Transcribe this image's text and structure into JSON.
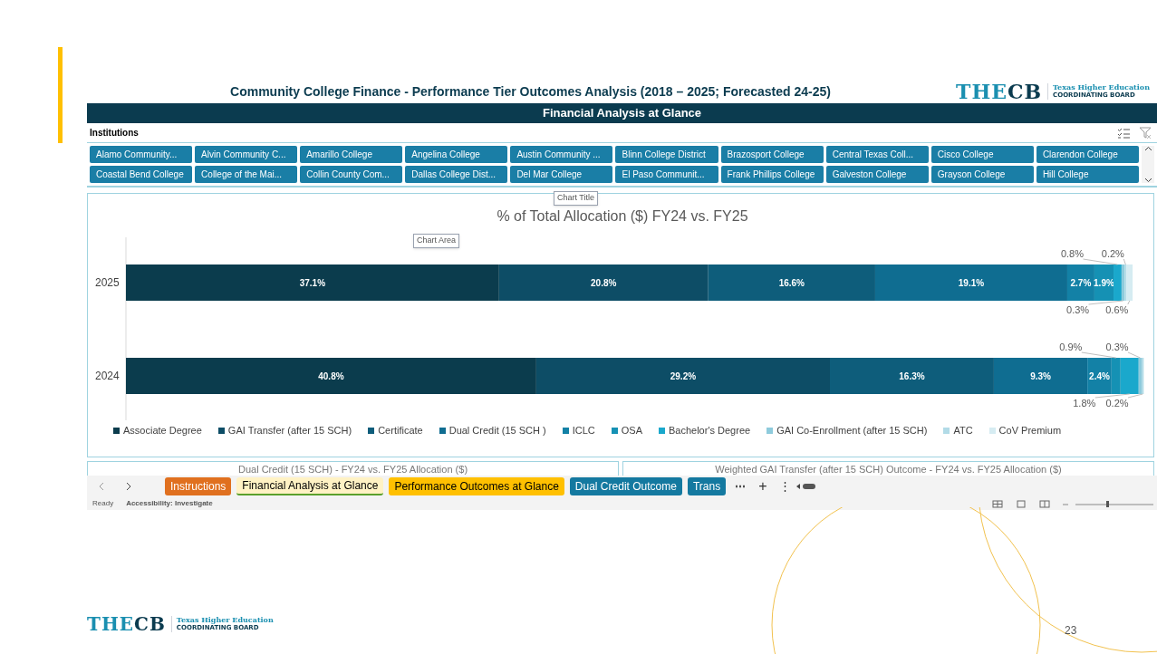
{
  "header": {
    "title": "Community College Finance - Performance Tier Outcomes Analysis (2018 – 2025; Forecasted 24-25)",
    "logo": {
      "part1": "THE",
      "part2": "CB",
      "tagline1": "Texas Higher Education",
      "tagline2": "COORDINATING BOARD"
    }
  },
  "banner": "Financial Analysis at Glance",
  "slicer": {
    "label": "Institutions",
    "items": [
      {
        "label": "Alamo Community..."
      },
      {
        "label": "Alvin Community C..."
      },
      {
        "label": "Amarillo College"
      },
      {
        "label": "Angelina College"
      },
      {
        "label": "Austin Community ..."
      },
      {
        "label": "Blinn College District"
      },
      {
        "label": "Brazosport College"
      },
      {
        "label": "Central Texas Coll..."
      },
      {
        "label": "Cisco College"
      },
      {
        "label": "Clarendon College"
      },
      {
        "label": "Coastal Bend College"
      },
      {
        "label": "College of the Mai..."
      },
      {
        "label": "Collin County Com..."
      },
      {
        "label": "Dallas College Dist..."
      },
      {
        "label": "Del Mar College"
      },
      {
        "label": "El Paso Communit..."
      },
      {
        "label": "Frank Phillips College"
      },
      {
        "label": "Galveston College"
      },
      {
        "label": "Grayson College"
      },
      {
        "label": "Hill College"
      }
    ]
  },
  "tooltips": {
    "chart_title": "Chart Title",
    "chart_area": "Chart Area"
  },
  "chart_data": {
    "type": "bar",
    "orientation": "horizontal",
    "stacked": true,
    "legend": true,
    "title": "% of Total Allocation ($) FY24 vs. FY25",
    "categories": [
      "2025",
      "2024"
    ],
    "series": [
      {
        "name": "Associate Degree",
        "color": "#0b3c4d",
        "values": [
          37.1,
          40.8
        ],
        "value_labels": [
          "37.1%",
          "40.8%"
        ]
      },
      {
        "name": "GAI Transfer (after 15 SCH)",
        "color": "#0d4d66",
        "values": [
          20.8,
          29.2
        ],
        "value_labels": [
          "20.8%",
          "29.2%"
        ]
      },
      {
        "name": "Certificate",
        "color": "#0e5d7b",
        "values": [
          16.6,
          16.3
        ],
        "value_labels": [
          "16.6%",
          "16.3%"
        ]
      },
      {
        "name": "Dual Credit (15 SCH )",
        "color": "#0f6d91",
        "values": [
          19.1,
          9.3
        ],
        "value_labels": [
          "19.1%",
          "9.3%"
        ]
      },
      {
        "name": "ICLC",
        "color": "#1381a6",
        "values": [
          2.7,
          2.4
        ],
        "value_labels": [
          "2.7%",
          "2.4%"
        ]
      },
      {
        "name": "OSA",
        "color": "#1591b4",
        "values": [
          1.9,
          0.9
        ],
        "value_labels": [
          "1.9%",
          "0.9%"
        ]
      },
      {
        "name": "Bachelor's Degree",
        "color": "#1aa8cc",
        "values": [
          0.8,
          1.8
        ],
        "value_labels": [
          "0.8%",
          "1.8%"
        ]
      },
      {
        "name": "GAI Co-Enrollment (after 15 SCH)",
        "color": "#8ecbdc",
        "values": [
          0.3,
          0.3
        ],
        "value_labels": [
          "0.3%",
          "0.3%"
        ]
      },
      {
        "name": "ATC",
        "color": "#b2dbe7",
        "values": [
          0.2,
          0.2
        ],
        "value_labels": [
          "0.2%",
          "0.2%"
        ]
      },
      {
        "name": "CoV Premium",
        "color": "#d6ecf2",
        "values": [
          0.6,
          null
        ],
        "value_labels": [
          "0.6%",
          null
        ]
      }
    ]
  },
  "lower_charts": [
    {
      "title": "Dual Credit (15 SCH) - FY24 vs. FY25 Allocation ($)"
    },
    {
      "title": "Weighted GAI Transfer (after 15 SCH) Outcome - FY24 vs. FY25 Allocation ($)"
    }
  ],
  "sheet_tabs": [
    {
      "label": "Instructions",
      "color": "#e0701f",
      "selected": false
    },
    {
      "label": "Financial Analysis at Glance",
      "color": "#fff2c4",
      "selected": true
    },
    {
      "label": "Performance Outcomes at Glance",
      "color": "#ffc000",
      "selected": false
    },
    {
      "label": "Dual Credit Outcome",
      "color": "#1479a0",
      "selected": false
    },
    {
      "label": "Trans",
      "color": "#1479a0",
      "selected": false
    }
  ],
  "tab_bar": {
    "more": "⋯",
    "add": "+",
    "options": "⋮"
  },
  "status_bar": {
    "ready": "Ready",
    "accessibility": "Accessibility: Investigate"
  },
  "footer": {
    "logo": {
      "part1": "THE",
      "part2": "CB",
      "tagline1": "Texas Higher Education",
      "tagline2": "COORDINATING BOARD"
    },
    "page_number": "23"
  }
}
